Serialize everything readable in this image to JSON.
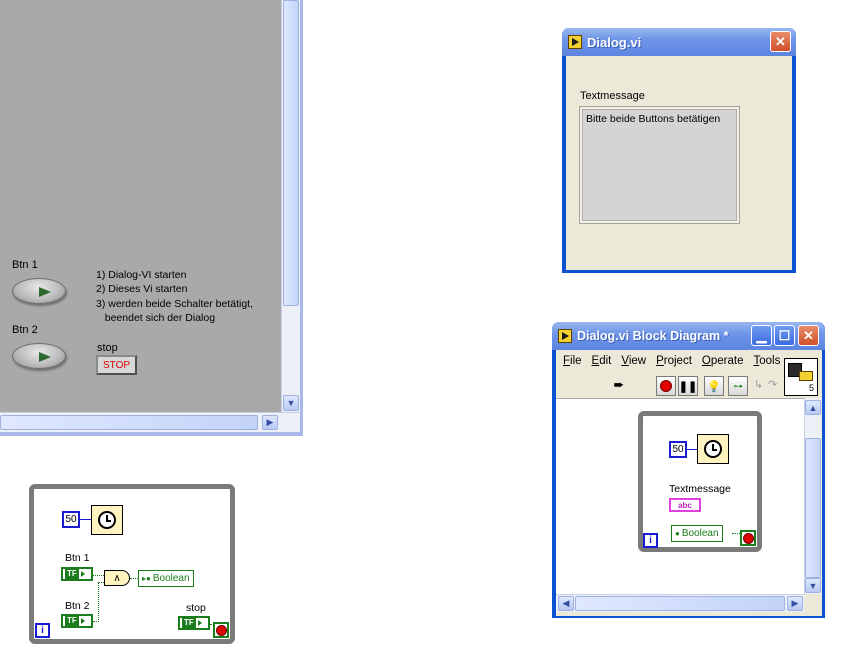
{
  "front_panel": {
    "btn1_label": "Btn 1",
    "btn2_label": "Btn 2",
    "instructions": "1) Dialog-VI starten\n2) Dieses Vi starten\n3) werden beide Schalter betätigt,\n   beendet sich der Dialog",
    "stop_label": "stop",
    "stop_button_text": "STOP"
  },
  "left_diagram": {
    "wait_constant": "50",
    "btn1_label": "Btn 1",
    "btn2_label": "Btn 2",
    "btn1_terminal": "TF",
    "btn2_terminal": "TF",
    "and_symbol": "∧",
    "property_node": "Boolean",
    "stop_label": "stop",
    "stop_terminal": "TF",
    "iteration": "i"
  },
  "dialog_window": {
    "title": "Dialog.vi",
    "textmessage_label": "Textmessage",
    "textmessage_value": "Bitte beide Buttons betätigen"
  },
  "bd_window": {
    "title": "Dialog.vi Block Diagram *",
    "menu": [
      {
        "label": "File",
        "ul": "F",
        "rest": "ile"
      },
      {
        "label": "Edit",
        "ul": "E",
        "rest": "dit"
      },
      {
        "label": "View",
        "ul": "V",
        "rest": "iew"
      },
      {
        "label": "Project",
        "ul": "P",
        "rest": "roject"
      },
      {
        "label": "Operate",
        "ul": "O",
        "rest": "perate"
      },
      {
        "label": "Tools",
        "ul": "T",
        "rest": "ools"
      }
    ],
    "wait_constant": "50",
    "textmessage_label": "Textmessage",
    "string_terminal": "abc",
    "property_node": "Boolean",
    "iteration": "i",
    "vi_icon_number": "5"
  }
}
